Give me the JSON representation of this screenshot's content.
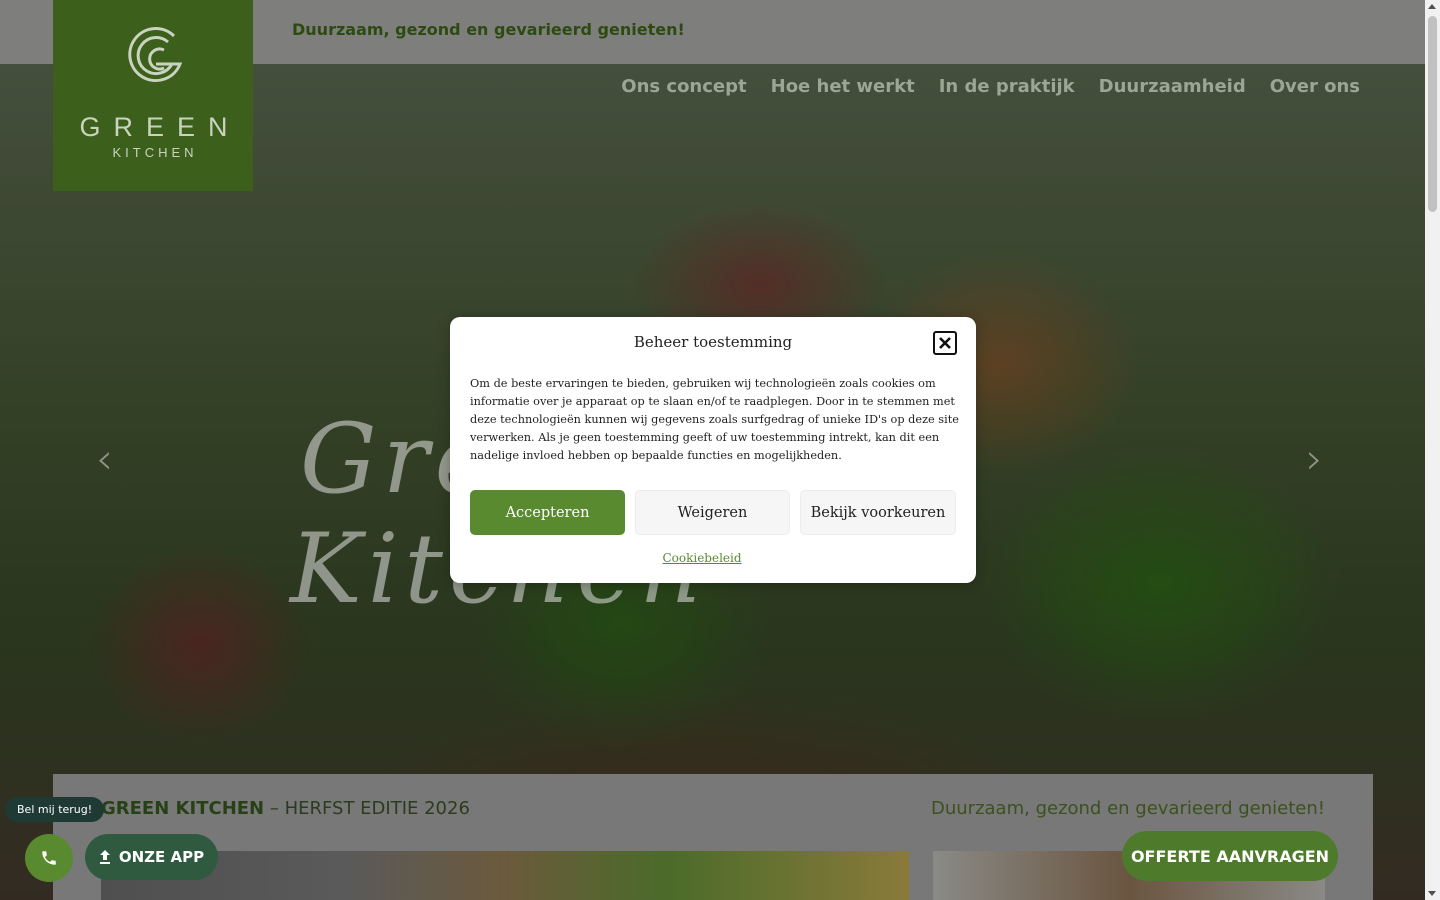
{
  "header": {
    "tagline": "Duurzaam, gezond en gevarieerd genieten!",
    "logo": {
      "text_main": "GREEN",
      "text_sub": "KITCHEN"
    },
    "nav": [
      "Ons concept",
      "Hoe het werkt",
      "In de praktijk",
      "Duurzaamheid",
      "Over ons"
    ]
  },
  "hero": {
    "script_line1": "Green",
    "script_line2": "Kitchen",
    "prev_icon": "chevron-left-icon",
    "next_icon": "chevron-right-icon"
  },
  "band": {
    "brand": "GREEN KITCHEN",
    "edition": " – HERFST EDITIE 2026",
    "tagline": "Duurzaam, gezond en gevarieerd genieten!"
  },
  "floating": {
    "callback_label": "Bel mij terug!",
    "phone_icon": "phone-icon",
    "app_label": "ONZE APP",
    "app_icon": "upload-icon",
    "quote_label": "OFFERTE AANVRAGEN"
  },
  "consent": {
    "title": "Beheer toestemming",
    "body": "Om de beste ervaringen te bieden, gebruiken wij technologieën zoals cookies om informatie over je apparaat op te slaan en/of te raadplegen. Door in te stemmen met deze technologieën kunnen wij gegevens zoals surfgedrag of unieke ID's op deze site verwerken. Als je geen toestemming geeft of uw toestemming intrekt, kan dit een nadelige invloed hebben op bepaalde functies en mogelijkheden.",
    "accept": "Accepteren",
    "deny": "Weigeren",
    "preferences": "Bekijk voorkeuren",
    "policy_link": "Cookiebeleid",
    "close_icon": "close-icon"
  },
  "colors": {
    "brand_green": "#3c5f1c",
    "accept_green": "#5a8a2f",
    "app_button": "#2f5a3f"
  }
}
